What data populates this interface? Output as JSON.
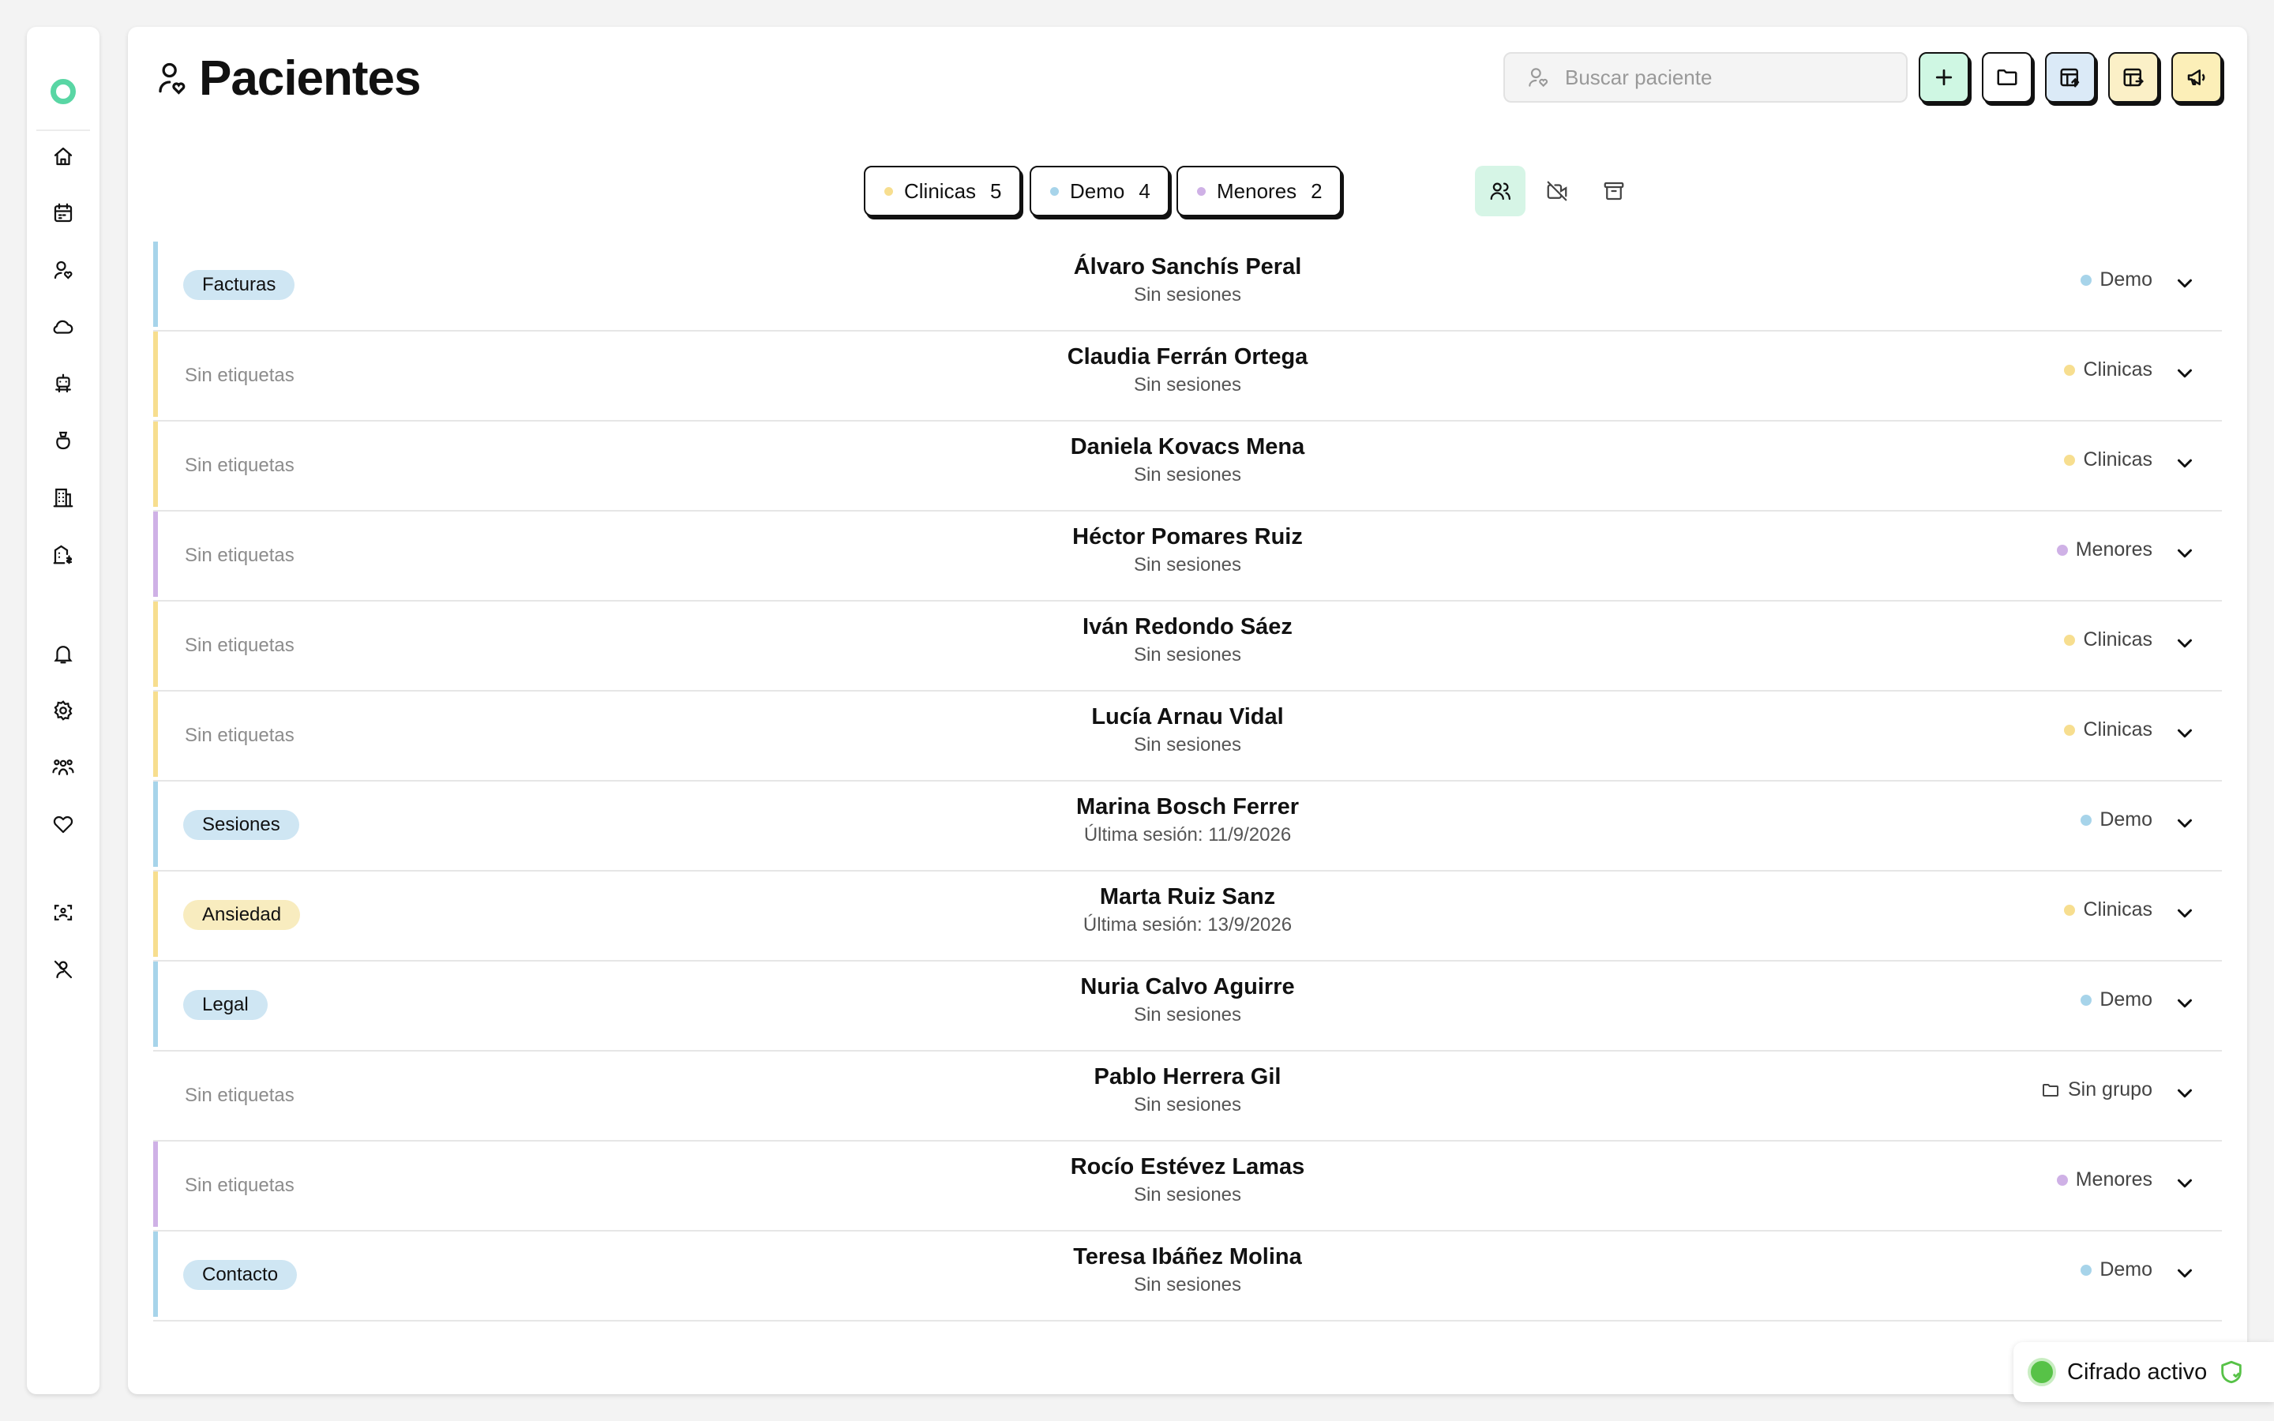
{
  "page": {
    "title": "Pacientes"
  },
  "search": {
    "placeholder": "Buscar paciente"
  },
  "colors": {
    "clinicas": "#f7de8f",
    "demo": "#a7d4ea",
    "menores": "#cfb1e6",
    "active_filter_bg": "#d6f5e6",
    "add_button_bg": "#cff7e3",
    "export_button_bg": "#dbeaf7",
    "import_button_bg": "#fbf0c7",
    "announce_button_bg": "#fcefb8"
  },
  "toolbar": {
    "buttons": [
      {
        "icon": "plus-icon"
      },
      {
        "icon": "folder-icon"
      },
      {
        "icon": "table-export-icon"
      },
      {
        "icon": "table-import-icon"
      },
      {
        "icon": "megaphone-icon"
      }
    ]
  },
  "sidebar": {
    "items": [
      {
        "icon": "home-icon"
      },
      {
        "icon": "calendar-icon"
      },
      {
        "icon": "patients-icon"
      },
      {
        "icon": "cloud-icon"
      },
      {
        "icon": "robot-icon"
      },
      {
        "icon": "bag-icon"
      },
      {
        "icon": "building-icon"
      },
      {
        "icon": "building-money-icon"
      },
      {
        "icon": "bell-icon"
      },
      {
        "icon": "settings-icon"
      },
      {
        "icon": "team-icon"
      },
      {
        "icon": "heart-icon"
      },
      {
        "icon": "face-scan-icon"
      },
      {
        "icon": "user-off-icon"
      }
    ]
  },
  "filters": {
    "groups": [
      {
        "label": "Clinicas",
        "count": "5"
      },
      {
        "label": "Demo",
        "count": "4"
      },
      {
        "label": "Menores",
        "count": "2"
      }
    ],
    "icons": [
      "users-filter-icon",
      "no-sessions-filter-icon",
      "archive-icon"
    ]
  },
  "patients": [
    {
      "name": "Álvaro Sanchís Peral",
      "sub": "Sin sesiones",
      "tag": "Facturas",
      "group": "Demo"
    },
    {
      "name": "Claudia Ferrán Ortega",
      "sub": "Sin sesiones",
      "tag": "Sin etiquetas",
      "group": "Clinicas"
    },
    {
      "name": "Daniela Kovacs Mena",
      "sub": "Sin sesiones",
      "tag": "Sin etiquetas",
      "group": "Clinicas"
    },
    {
      "name": "Héctor Pomares Ruiz",
      "sub": "Sin sesiones",
      "tag": "Sin etiquetas",
      "group": "Menores"
    },
    {
      "name": "Iván Redondo Sáez",
      "sub": "Sin sesiones",
      "tag": "Sin etiquetas",
      "group": "Clinicas"
    },
    {
      "name": "Lucía Arnau Vidal",
      "sub": "Sin sesiones",
      "tag": "Sin etiquetas",
      "group": "Clinicas"
    },
    {
      "name": "Marina Bosch Ferrer",
      "sub": "Última sesión: 11/9/2026",
      "tag": "Sesiones",
      "group": "Demo"
    },
    {
      "name": "Marta Ruiz Sanz",
      "sub": "Última sesión: 13/9/2026",
      "tag": "Ansiedad",
      "group": "Clinicas"
    },
    {
      "name": "Nuria Calvo Aguirre",
      "sub": "Sin sesiones",
      "tag": "Legal",
      "group": "Demo"
    },
    {
      "name": "Pablo Herrera Gil",
      "sub": "Sin sesiones",
      "tag": "Sin etiquetas",
      "group": "Sin grupo"
    },
    {
      "name": "Rocío Estévez Lamas",
      "sub": "Sin sesiones",
      "tag": "Sin etiquetas",
      "group": "Menores"
    },
    {
      "name": "Teresa Ibáñez Molina",
      "sub": "Sin sesiones",
      "tag": "Contacto",
      "group": "Demo"
    }
  ],
  "status": {
    "encryption": "Cifrado activo"
  }
}
